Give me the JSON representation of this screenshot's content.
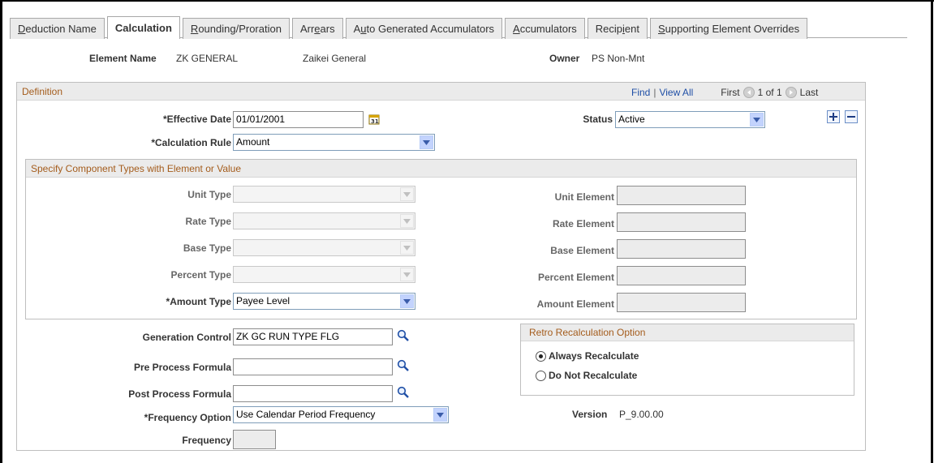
{
  "tabs": [
    {
      "label": "Deduction Name",
      "pre": "",
      "u": "D",
      "post": "eduction Name",
      "active": false
    },
    {
      "label": "Calculation",
      "pre": "",
      "u": "",
      "post": "Calculation",
      "active": true
    },
    {
      "label": "Rounding/Proration",
      "pre": "",
      "u": "R",
      "post": "ounding/Proration",
      "active": false
    },
    {
      "label": "Arrears",
      "pre": "Arr",
      "u": "e",
      "post": "ars",
      "active": false
    },
    {
      "label": "Auto Generated Accumulators",
      "pre": "A",
      "u": "u",
      "post": "to Generated Accumulators",
      "active": false
    },
    {
      "label": "Accumulators",
      "pre": "",
      "u": "A",
      "post": "ccumulators",
      "active": false
    },
    {
      "label": "Recipient",
      "pre": "Recip",
      "u": "i",
      "post": "ent",
      "active": false
    },
    {
      "label": "Supporting Element Overrides",
      "pre": "",
      "u": "S",
      "post": "upporting Element Overrides",
      "active": false
    }
  ],
  "header": {
    "element_name_label": "Element Name",
    "element_name": "ZK GENERAL",
    "description": "Zaikei General",
    "owner_label": "Owner",
    "owner": "PS Non-Mnt"
  },
  "definition": {
    "title": "Definition",
    "find": "Find",
    "separator": "|",
    "view_all": "View All",
    "first": "First",
    "range": "1 of 1",
    "last": "Last",
    "effective_date_label": "*Effective Date",
    "effective_date": "01/01/2001",
    "status_label": "Status",
    "status": "Active",
    "calc_rule_label": "*Calculation Rule",
    "calc_rule": "Amount"
  },
  "components": {
    "title": "Specify Component Types with Element or Value",
    "unit_type_label": "Unit Type",
    "rate_type_label": "Rate Type",
    "base_type_label": "Base Type",
    "percent_type_label": "Percent Type",
    "amount_type_label": "*Amount Type",
    "amount_type": "Payee Level",
    "unit_element_label": "Unit Element",
    "rate_element_label": "Rate Element",
    "base_element_label": "Base Element",
    "percent_element_label": "Percent Element",
    "amount_element_label": "Amount Element"
  },
  "lower": {
    "generation_control_label": "Generation Control",
    "generation_control": "ZK GC RUN TYPE FLG",
    "pre_process_label": "Pre Process Formula",
    "pre_process": "",
    "post_process_label": "Post Process Formula",
    "post_process": "",
    "frequency_option_label": "*Frequency Option",
    "frequency_option": "Use Calendar Period Frequency",
    "frequency_label": "Frequency",
    "frequency": "",
    "version_label": "Version",
    "version": "P_9.00.00"
  },
  "retro": {
    "title": "Retro Recalculation Option",
    "always": "Always Recalculate",
    "never": "Do Not Recalculate",
    "selected": "always"
  },
  "colors": {
    "section_title": "#a45c1c",
    "link": "#1f4fa6",
    "select_arrow": "#c3d3fd"
  }
}
